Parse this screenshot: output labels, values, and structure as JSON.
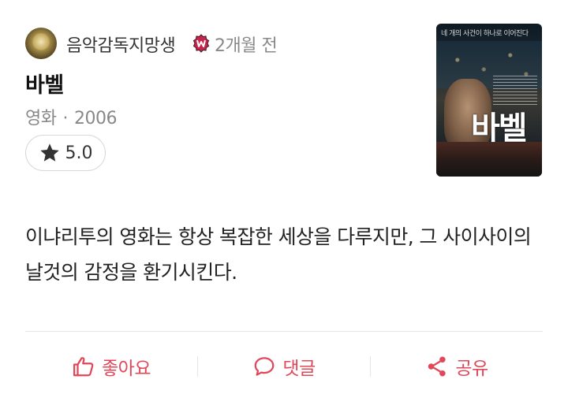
{
  "post": {
    "author": "음악감독지망생",
    "time_ago": "2개월 전",
    "title": "바벨",
    "category": "영화",
    "year": "2006",
    "rating": "5.0",
    "body": "이냐리투의 영화는 항상 복잡한 세상을 다루지만, 그 사이사이의 날것의 감정을 환기시킨다."
  },
  "poster": {
    "tagline": "네 개의 사건이 하나로 이어진다",
    "title_text": "바벨"
  },
  "actions": {
    "like_label": "좋아요",
    "comment_label": "댓글",
    "share_label": "공유"
  },
  "colors": {
    "accent": "#e0485a",
    "badge": "#c8234a",
    "muted": "#888888"
  },
  "icons": [
    "star-icon",
    "badge-icon",
    "thumbs-up-icon",
    "comment-icon",
    "share-icon"
  ]
}
